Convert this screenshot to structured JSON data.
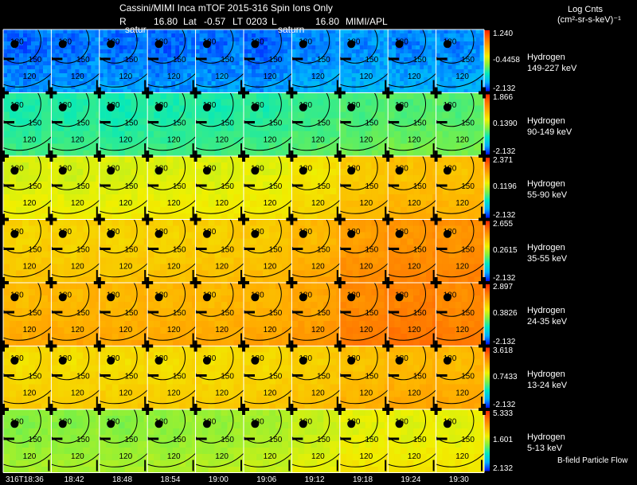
{
  "header": {
    "title": "Cassini/MIMI Inca mTOF  2015-316   Spin   Ions Only",
    "r_label": "R",
    "r_value": "16.80",
    "lat_label": "Lat",
    "lat_value": "-0.57",
    "lt_label": "LT",
    "lt_value": "0203",
    "l_label": "L",
    "l_value": "16.80",
    "institution": "MIMI/APL",
    "planet_label_1": "satur",
    "planet_label_2": "saturn"
  },
  "units": {
    "title": "Log Cnts",
    "label": "(cm²-sr-s-keV)⁻¹"
  },
  "footer": {
    "bfield_note": "B-field Particle Flow"
  },
  "chart_data": {
    "type": "heatmap",
    "title": "Cassini/MIMI Inca mTOF  2015-316   Spin   Ions Only",
    "x": [
      "316T18:36",
      "18:42",
      "18:48",
      "18:54",
      "19:00",
      "19:06",
      "19:12",
      "19:18",
      "19:24",
      "19:30"
    ],
    "contour_labels": [
      "180",
      "150",
      "120"
    ],
    "colorscale": [
      "#0010ff",
      "#00b0ff",
      "#00e8c0",
      "#80f040",
      "#f0f000",
      "#ffb000",
      "#ff7000",
      "#ff2000"
    ],
    "rows": [
      {
        "species": "Hydrogen",
        "energy": "149-227 keV",
        "cb_max": "1.240",
        "cb_mid": "-0.4458",
        "cb_min": "-2.132",
        "levels": [
          0.12,
          0.13,
          0.13,
          0.12,
          0.13,
          0.12,
          0.15,
          0.16,
          0.15,
          0.15
        ]
      },
      {
        "species": "Hydrogen",
        "energy": "90-149 keV",
        "cb_max": "1.866",
        "cb_mid": "0.1390",
        "cb_min": "-2.132",
        "levels": [
          0.36,
          0.36,
          0.35,
          0.36,
          0.36,
          0.37,
          0.39,
          0.41,
          0.42,
          0.42
        ]
      },
      {
        "species": "Hydrogen",
        "energy": "55-90 keV",
        "cb_max": "2.371",
        "cb_mid": "0.1196",
        "cb_min": "-2.132",
        "levels": [
          0.58,
          0.58,
          0.58,
          0.59,
          0.59,
          0.6,
          0.64,
          0.7,
          0.72,
          0.72
        ]
      },
      {
        "species": "Hydrogen",
        "energy": "35-55 keV",
        "cb_max": "2.655",
        "cb_mid": "0.2615",
        "cb_min": "-2.132",
        "levels": [
          0.68,
          0.68,
          0.68,
          0.68,
          0.69,
          0.7,
          0.74,
          0.8,
          0.82,
          0.82
        ]
      },
      {
        "species": "Hydrogen",
        "energy": "24-35 keV",
        "cb_max": "2.897",
        "cb_mid": "0.3826",
        "cb_min": "-2.132",
        "levels": [
          0.74,
          0.74,
          0.74,
          0.74,
          0.74,
          0.75,
          0.78,
          0.84,
          0.86,
          0.84
        ]
      },
      {
        "species": "Hydrogen",
        "energy": "13-24 keV",
        "cb_max": "3.618",
        "cb_mid": "0.7433",
        "cb_min": "-2.132",
        "levels": [
          0.66,
          0.66,
          0.66,
          0.66,
          0.66,
          0.67,
          0.69,
          0.72,
          0.74,
          0.74
        ]
      },
      {
        "species": "Hydrogen",
        "energy": "5-13 keV",
        "cb_max": "5.333",
        "cb_mid": "1.601",
        "cb_min": "2.132",
        "levels": [
          0.48,
          0.48,
          0.48,
          0.49,
          0.5,
          0.52,
          0.56,
          0.6,
          0.6,
          0.6
        ]
      }
    ]
  }
}
